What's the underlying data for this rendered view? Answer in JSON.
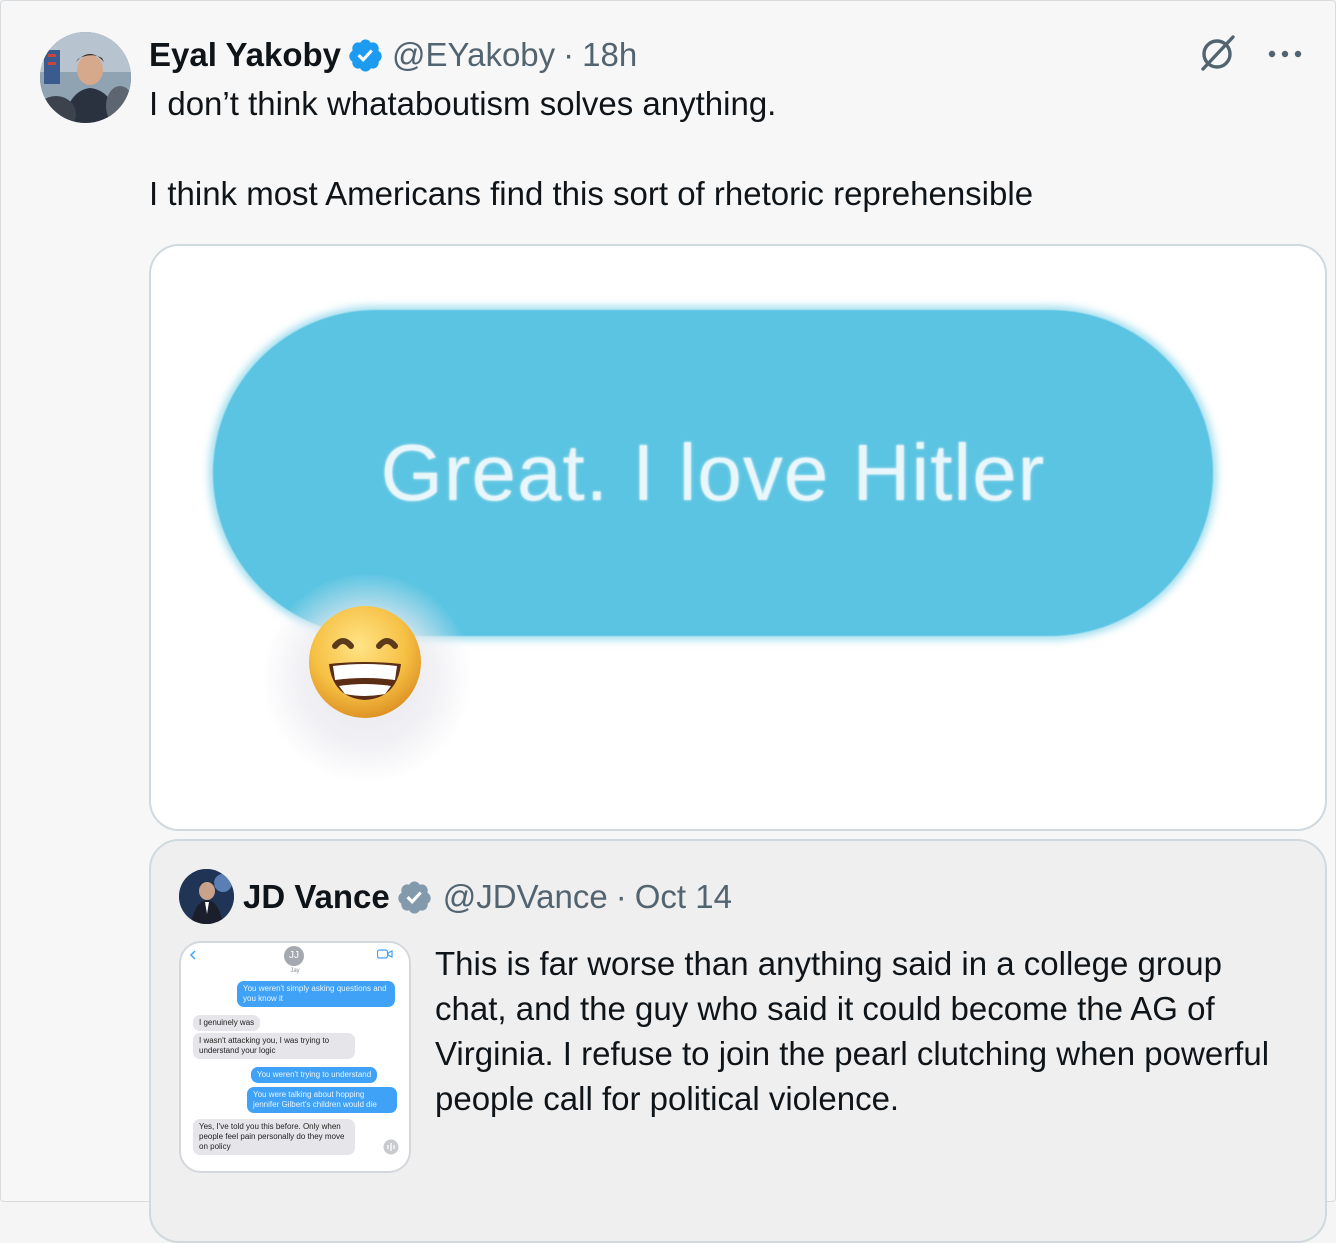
{
  "tweet": {
    "author": {
      "display_name": "Eyal Yakoby",
      "handle": "@EYakoby",
      "time": "18h",
      "separator": "·"
    },
    "text_lines": [
      "I don’t think whataboutism solves anything.",
      "I think most Americans find this sort of rhetoric reprehensible"
    ],
    "media": {
      "bubble_text": "Great. I love Hitler",
      "reaction_emoji": "😁"
    }
  },
  "quoted": {
    "author": {
      "display_name": "JD Vance",
      "handle": "@JDVance",
      "time": "Oct 14",
      "separator": "·"
    },
    "text": "This is far worse than anything said in a college group chat, and the guy who said it could become the AG of Virginia. I refuse to join the pearl clutching when powerful people call for political violence.",
    "thumbnail": {
      "contact_initials": "JJ",
      "contact_name": "Jay",
      "messages": [
        {
          "dir": "out",
          "text": "You weren't simply asking questions and you know it"
        },
        {
          "dir": "in",
          "text": "I genuinely was"
        },
        {
          "dir": "in",
          "text": "I wasn't attacking you, I was trying to understand your logic"
        },
        {
          "dir": "out",
          "text": "You weren't trying to understand"
        },
        {
          "dir": "out",
          "text": "You were talking about hopping jennifer Gilbert's children would die"
        },
        {
          "dir": "in",
          "text": "Yes, I've told you this before. Only when people feel pain personally do they move on policy"
        }
      ]
    }
  },
  "icons": [
    "verified-badge-icon",
    "grok-icon",
    "more-icon"
  ],
  "colors": {
    "verified": "#1d9bf0",
    "quoted_verified": "#829aab",
    "bubble": "#5ac4e2",
    "secondary_text": "#536471"
  }
}
